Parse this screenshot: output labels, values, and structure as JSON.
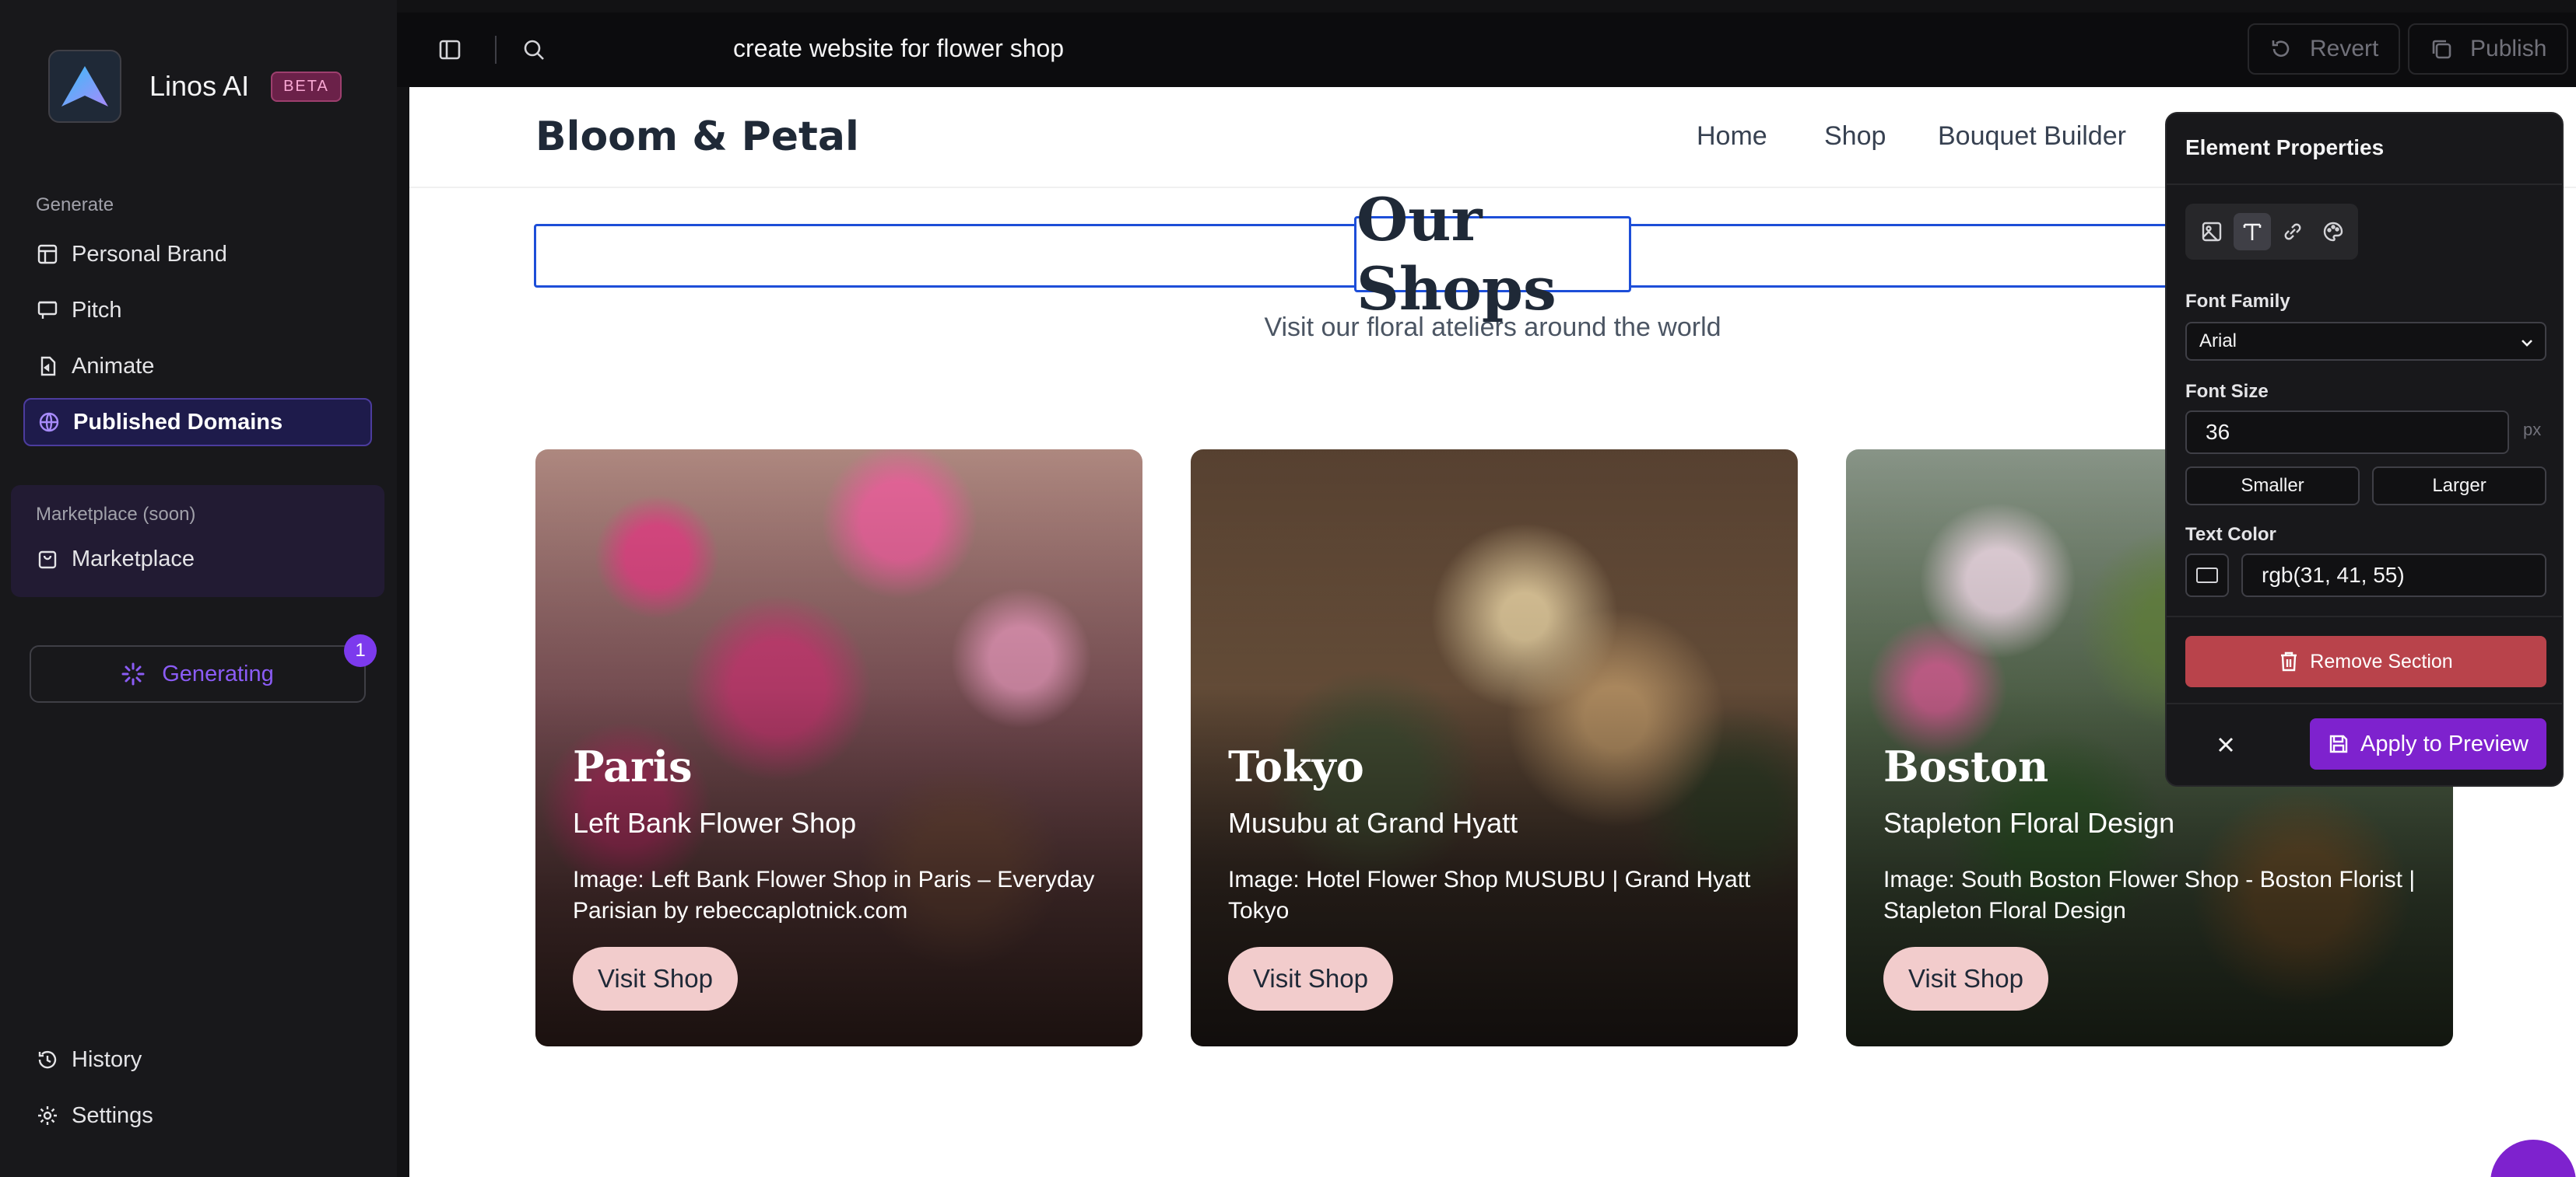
{
  "app": {
    "name": "Linos AI",
    "badge": "BETA"
  },
  "sidebar": {
    "generate_label": "Generate",
    "generate_items": [
      {
        "label": "Personal Brand",
        "icon": "layout-icon"
      },
      {
        "label": "Pitch",
        "icon": "presentation-icon"
      },
      {
        "label": "Animate",
        "icon": "file-icon"
      },
      {
        "label": "Published Domains",
        "icon": "globe-icon",
        "active": true
      }
    ],
    "marketplace_label": "Marketplace (soon)",
    "marketplace_item": "Marketplace",
    "generating_label": "Generating",
    "generating_count": "1",
    "history_label": "History",
    "settings_label": "Settings"
  },
  "topbar": {
    "prompt": "create website for flower shop",
    "revert_label": "Revert",
    "publish_label": "Publish"
  },
  "site": {
    "logo": "Bloom & Petal",
    "nav": [
      "Home",
      "Shop",
      "Bouquet Builder"
    ],
    "title": "Our Shops",
    "subtitle": "Visit our floral ateliers around the world",
    "cards": [
      {
        "city": "Paris",
        "shop": "Left Bank Flower Shop",
        "caption": "Image: Left Bank Flower Shop in Paris – Everyday Parisian by rebeccaplotnick.com",
        "button": "Visit Shop"
      },
      {
        "city": "Tokyo",
        "shop": "Musubu at Grand Hyatt",
        "caption": "Image: Hotel Flower Shop MUSUBU | Grand Hyatt Tokyo",
        "button": "Visit Shop"
      },
      {
        "city": "Boston",
        "shop": "Stapleton Floral Design",
        "caption": "Image: South Boston Flower Shop - Boston Florist | Stapleton Floral Design",
        "button": "Visit Shop"
      }
    ]
  },
  "properties": {
    "title": "Element Properties",
    "font_family_label": "Font Family",
    "font_family_value": "Arial",
    "font_size_label": "Font Size",
    "font_size_value": "36",
    "font_size_unit": "px",
    "smaller_label": "Smaller",
    "larger_label": "Larger",
    "text_color_label": "Text Color",
    "text_color_value": "rgb(31, 41, 55)",
    "remove_label": "Remove Section",
    "apply_label": "Apply to Preview"
  },
  "colors": {
    "accent": "#7e22ce",
    "selection": "#1d4ed8",
    "danger": "#b9434b",
    "button_pink": "#f2cccc"
  }
}
